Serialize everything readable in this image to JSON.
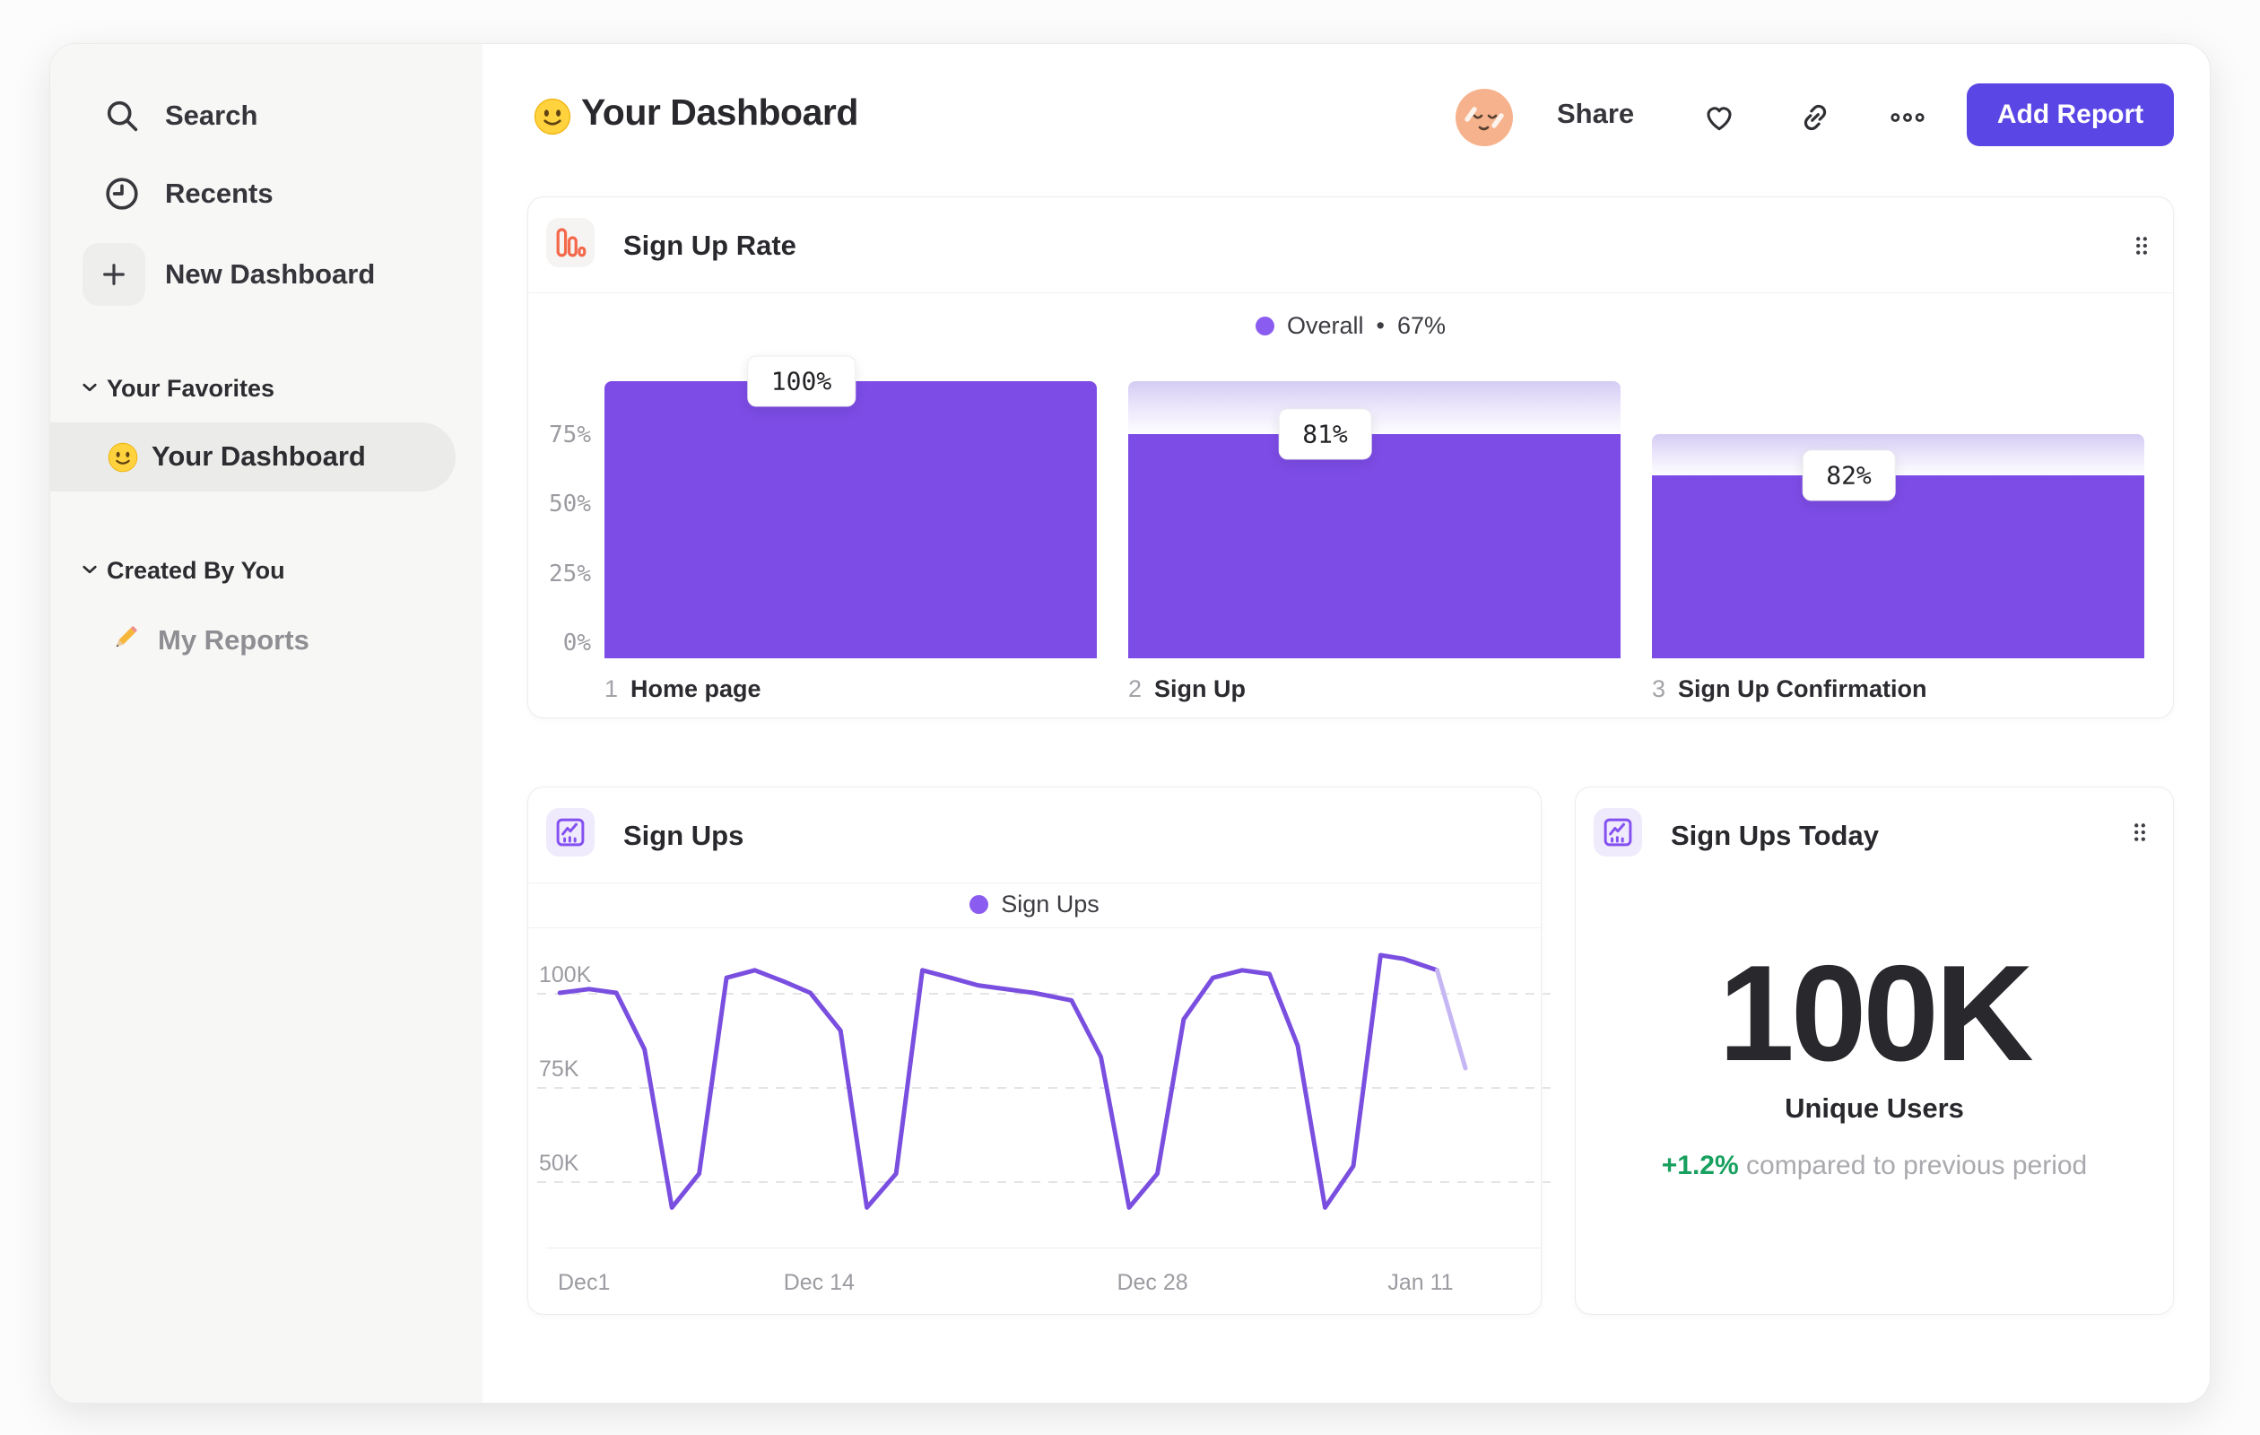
{
  "colors": {
    "accent": "#5946e4",
    "bar": "#7d4ce6",
    "bar_light_top": "#d5ccf4",
    "line": "#7a4fe0",
    "line_fade": "#c7b6f4",
    "legend_dot": "#8b5cf0",
    "green": "#17a05e",
    "orange": "#f4694c",
    "icon_purple": "#8450f0"
  },
  "sidebar": {
    "nav": [
      {
        "label": "Search",
        "icon": "search-icon"
      },
      {
        "label": "Recents",
        "icon": "clock-icon"
      },
      {
        "label": "New Dashboard",
        "icon": "plus-icon"
      }
    ],
    "sections": [
      {
        "title": "Your Favorites",
        "items": [
          {
            "label": "Your Dashboard",
            "icon": "smiley-emoji",
            "selected": true
          }
        ]
      },
      {
        "title": "Created By You",
        "items": [
          {
            "label": "My Reports",
            "icon": "pencil-emoji",
            "selected": false
          }
        ]
      }
    ]
  },
  "header": {
    "title": "Your Dashboard",
    "title_emoji": "smiley-emoji",
    "share": "Share",
    "add_report": "Add Report"
  },
  "cards": {
    "signup_rate": {
      "title": "Sign Up Rate",
      "legend": {
        "series": "Overall",
        "separator": "•",
        "value": "67%"
      },
      "y_ticks": [
        "75%",
        "50%",
        "25%",
        "0%"
      ]
    },
    "signups": {
      "title": "Sign Ups",
      "legend": {
        "series": "Sign Ups"
      },
      "y_ticks": [
        "100K",
        "75K",
        "50K"
      ],
      "x_ticks": [
        "Dec1",
        "Dec 14",
        "Dec 28",
        "Jan 11"
      ]
    },
    "signups_today": {
      "title": "Sign Ups Today",
      "value": "100K",
      "metric": "Unique Users",
      "delta": "+1.2%",
      "delta_note": "compared to previous period"
    }
  },
  "chart_data": [
    {
      "type": "bar",
      "title": "Sign Up Rate",
      "categories": [
        "Home page",
        "Sign Up",
        "Sign Up Confirmation"
      ],
      "step_indices": [
        "1",
        "2",
        "3"
      ],
      "series": [
        {
          "name": "Overall",
          "values": [
            100,
            81,
            66
          ]
        }
      ],
      "prev_levels": [
        100,
        100,
        81
      ],
      "step_labels": [
        "100%",
        "81%",
        "82%"
      ],
      "ylim": [
        0,
        100
      ],
      "y_ticks": [
        75,
        50,
        25,
        0
      ],
      "overall_conversion": "67%",
      "legend_position": "top-center",
      "grid": false
    },
    {
      "type": "line",
      "title": "Sign Ups",
      "series_name": "Sign Ups",
      "x_ticks": [
        "Dec1",
        "Dec 14",
        "Dec 28",
        "Jan 11"
      ],
      "x_tick_fractions": [
        0,
        0.268,
        0.61,
        0.885
      ],
      "gridlines": [
        100,
        75,
        50
      ],
      "ylim_k": [
        31,
        114
      ],
      "grid": "dashed",
      "legend_position": "top-center",
      "fade_tail_from_index": 30,
      "points": [
        [
          0.002,
          100
        ],
        [
          0.032,
          101
        ],
        [
          0.06,
          100
        ],
        [
          0.089,
          85
        ],
        [
          0.117,
          43
        ],
        [
          0.145,
          52
        ],
        [
          0.173,
          104
        ],
        [
          0.202,
          106
        ],
        [
          0.232,
          103
        ],
        [
          0.259,
          100
        ],
        [
          0.29,
          90
        ],
        [
          0.317,
          43
        ],
        [
          0.347,
          52
        ],
        [
          0.374,
          106
        ],
        [
          0.403,
          104
        ],
        [
          0.431,
          102
        ],
        [
          0.488,
          100
        ],
        [
          0.527,
          98
        ],
        [
          0.557,
          83
        ],
        [
          0.586,
          43
        ],
        [
          0.615,
          52
        ],
        [
          0.642,
          93
        ],
        [
          0.672,
          104
        ],
        [
          0.702,
          106
        ],
        [
          0.73,
          105
        ],
        [
          0.759,
          86
        ],
        [
          0.787,
          43
        ],
        [
          0.816,
          54
        ],
        [
          0.844,
          110
        ],
        [
          0.868,
          109
        ],
        [
          0.902,
          106
        ],
        [
          0.931,
          80
        ]
      ]
    }
  ]
}
